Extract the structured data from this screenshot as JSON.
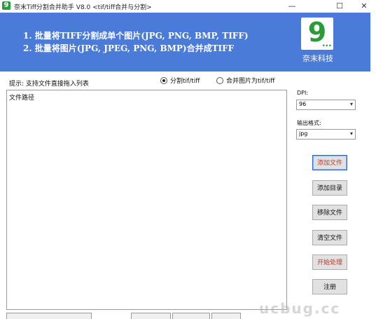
{
  "window": {
    "title": "奈末Tiff分割合并助手 V8.0 <tif/tiff合并与分割>",
    "icon_glyph": "9",
    "minimize_glyph": "—",
    "maximize_glyph": "☐",
    "close_glyph": "✕"
  },
  "banner": {
    "line1": "1. 批量将TIFF分割成单个图片(JPG, PNG, BMP, TIFF)",
    "line2": "2. 批量将图片(JPG, JPEG, PNG, BMP)合并成TIFF",
    "logo_text": "9",
    "logo_dots": "...",
    "logo_caption": "奈末科技",
    "background_color": "#4b7bd8"
  },
  "main": {
    "tip": "提示: 支持文件直接拖入列表",
    "radio_split": {
      "label": "分割tif/tiff",
      "selected": true
    },
    "radio_merge": {
      "label": "合并图片为tif/tiff",
      "selected": false
    },
    "list_header": "文件路径"
  },
  "settings": {
    "dpi_label": "DPI:",
    "dpi_value": "96",
    "format_label": "输出格式:",
    "format_value": "jpg"
  },
  "buttons": {
    "add_file": {
      "label": "添加文件",
      "color": "#c0392b"
    },
    "add_dir": {
      "label": "添加目录",
      "color": "#111111"
    },
    "remove_file": {
      "label": "移除文件",
      "color": "#111111"
    },
    "clear_files": {
      "label": "清空文件",
      "color": "#111111"
    },
    "start": {
      "label": "开始处理",
      "color": "#c0392b"
    },
    "register": {
      "label": "注册",
      "color": "#111111"
    }
  },
  "watermark": "ucbug.cc"
}
